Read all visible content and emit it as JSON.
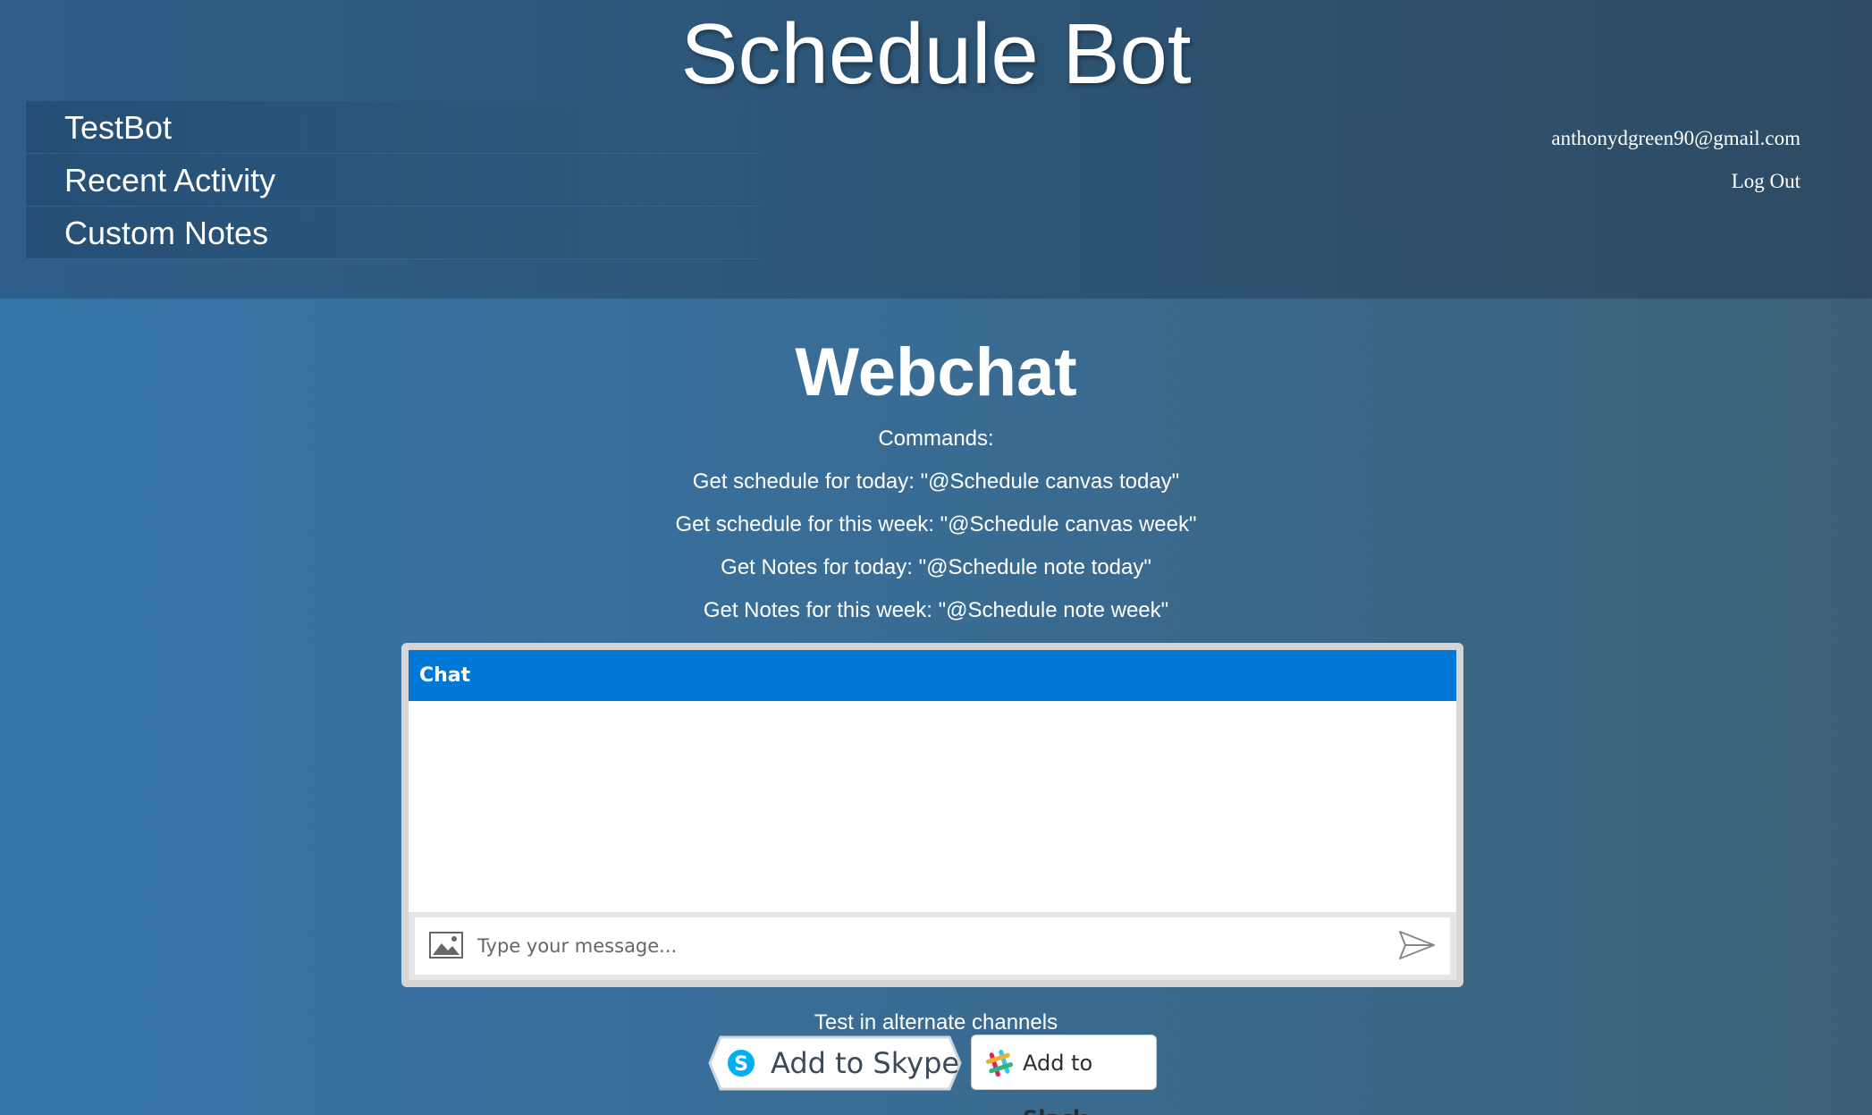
{
  "header": {
    "title": "Schedule Bot",
    "nav": [
      "TestBot",
      "Recent Activity",
      "Custom Notes"
    ],
    "user_email": "anthonydgreen90@gmail.com",
    "logout_label": "Log Out"
  },
  "main": {
    "title": "Webchat",
    "commands_heading": "Commands:",
    "commands": [
      "Get schedule for today: \"@Schedule canvas today\"",
      "Get schedule for this week: \"@Schedule canvas week\"",
      "Get Notes for today: \"@Schedule note today\"",
      "Get Notes for this week: \"@Schedule note week\""
    ]
  },
  "chat": {
    "header": "Chat",
    "placeholder": "Type your message..."
  },
  "channels": {
    "label": "Test in alternate channels",
    "skype_label": "Add to Skype",
    "slack_prefix": "Add to ",
    "slack_name": "Slack"
  },
  "colors": {
    "chat_header": "#0078d7",
    "skype_blue": "#00aff0"
  }
}
